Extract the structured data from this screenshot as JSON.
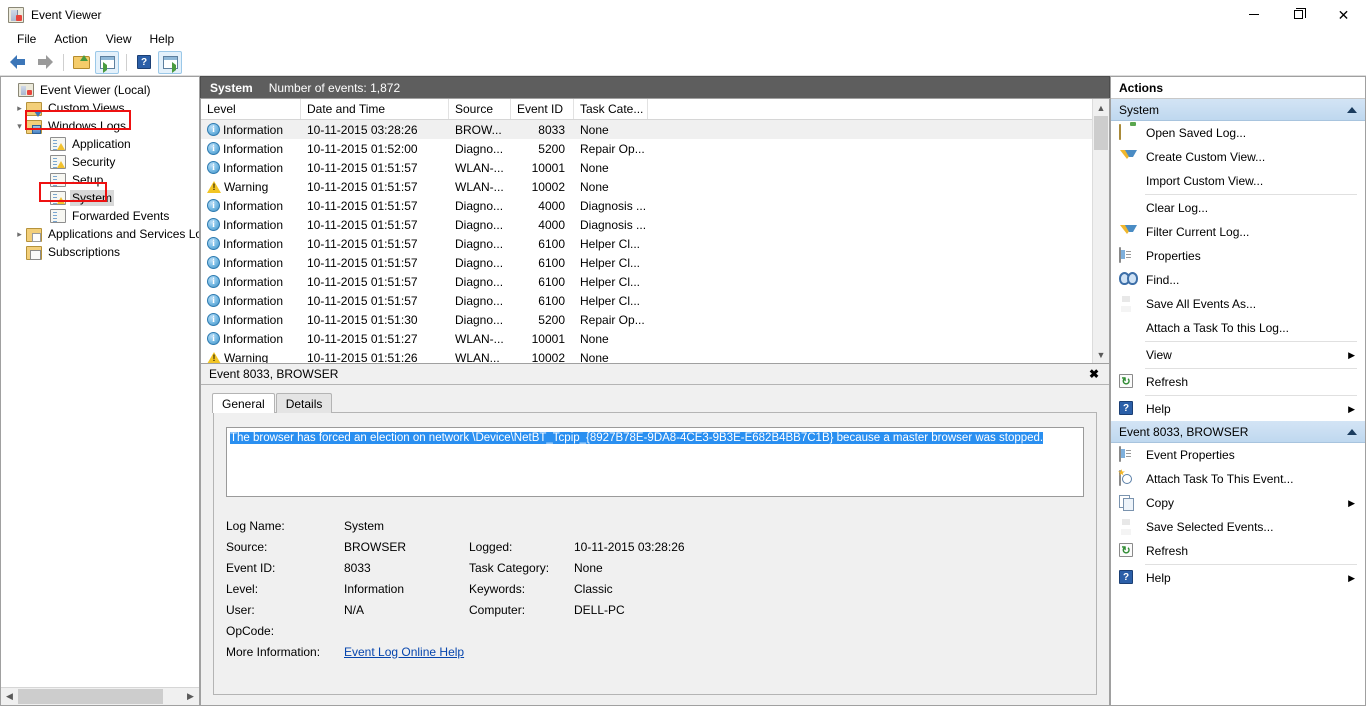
{
  "window": {
    "title": "Event Viewer",
    "app_icon": "event-viewer-icon",
    "minimize": "—",
    "maximize": "❐",
    "close": "✕"
  },
  "menubar": [
    "File",
    "Action",
    "View",
    "Help"
  ],
  "toolbar": [
    {
      "name": "back-button",
      "icon": "back-arrow-icon"
    },
    {
      "name": "forward-button",
      "icon": "forward-arrow-icon"
    },
    {
      "name": "open-saved-log-button",
      "icon": "folder-open-icon"
    },
    {
      "name": "show-hide-console-tree-button",
      "icon": "console-tree-icon"
    },
    {
      "name": "help-button",
      "icon": "question-mark-icon"
    },
    {
      "name": "show-hide-action-pane-button",
      "icon": "action-pane-icon"
    }
  ],
  "tree": {
    "items": [
      {
        "label": "Event Viewer (Local)",
        "indent": 0,
        "expander": "",
        "icon": "event-viewer-icon",
        "selected": false,
        "annotated": false
      },
      {
        "label": "Custom Views",
        "indent": 1,
        "expander": "›",
        "icon": "folder-filter-icon",
        "selected": false,
        "annotated": false
      },
      {
        "label": "Windows Logs",
        "indent": 1,
        "expander": "∨",
        "icon": "folder-windows-icon",
        "selected": false,
        "annotated": true
      },
      {
        "label": "Application",
        "indent": 2,
        "expander": "",
        "icon": "log-warning-icon",
        "selected": false,
        "annotated": false
      },
      {
        "label": "Security",
        "indent": 2,
        "expander": "",
        "icon": "log-warning-icon",
        "selected": false,
        "annotated": false
      },
      {
        "label": "Setup",
        "indent": 2,
        "expander": "",
        "icon": "log-icon",
        "selected": false,
        "annotated": false
      },
      {
        "label": "System",
        "indent": 2,
        "expander": "",
        "icon": "log-warning-icon",
        "selected": true,
        "annotated": true
      },
      {
        "label": "Forwarded Events",
        "indent": 2,
        "expander": "",
        "icon": "log-icon",
        "selected": false,
        "annotated": false
      },
      {
        "label": "Applications and Services Lo",
        "indent": 1,
        "expander": "›",
        "icon": "folder-services-icon",
        "selected": false,
        "annotated": false
      },
      {
        "label": "Subscriptions",
        "indent": 1,
        "expander": "",
        "icon": "subscriptions-icon",
        "selected": false,
        "annotated": false
      }
    ],
    "hscroll": {
      "left_arrow": "‹",
      "right_arrow": "›"
    }
  },
  "center": {
    "header": {
      "log_name": "System",
      "count_label": "Number of events: 1,872"
    },
    "columns": [
      "Level",
      "Date and Time",
      "Source",
      "Event ID",
      "Task Cate..."
    ],
    "rows": [
      {
        "level": "Information",
        "icon": "information-icon",
        "date": "10-11-2015 03:28:26",
        "source": "BROW...",
        "event_id": "8033",
        "task": "None",
        "selected": true
      },
      {
        "level": "Information",
        "icon": "information-icon",
        "date": "10-11-2015 01:52:00",
        "source": "Diagno...",
        "event_id": "5200",
        "task": "Repair Op...",
        "selected": false
      },
      {
        "level": "Information",
        "icon": "information-icon",
        "date": "10-11-2015 01:51:57",
        "source": "WLAN-...",
        "event_id": "10001",
        "task": "None",
        "selected": false
      },
      {
        "level": "Warning",
        "icon": "warning-icon",
        "date": "10-11-2015 01:51:57",
        "source": "WLAN-...",
        "event_id": "10002",
        "task": "None",
        "selected": false
      },
      {
        "level": "Information",
        "icon": "information-icon",
        "date": "10-11-2015 01:51:57",
        "source": "Diagno...",
        "event_id": "4000",
        "task": "Diagnosis ...",
        "selected": false
      },
      {
        "level": "Information",
        "icon": "information-icon",
        "date": "10-11-2015 01:51:57",
        "source": "Diagno...",
        "event_id": "4000",
        "task": "Diagnosis ...",
        "selected": false
      },
      {
        "level": "Information",
        "icon": "information-icon",
        "date": "10-11-2015 01:51:57",
        "source": "Diagno...",
        "event_id": "6100",
        "task": "Helper Cl...",
        "selected": false
      },
      {
        "level": "Information",
        "icon": "information-icon",
        "date": "10-11-2015 01:51:57",
        "source": "Diagno...",
        "event_id": "6100",
        "task": "Helper Cl...",
        "selected": false
      },
      {
        "level": "Information",
        "icon": "information-icon",
        "date": "10-11-2015 01:51:57",
        "source": "Diagno...",
        "event_id": "6100",
        "task": "Helper Cl...",
        "selected": false
      },
      {
        "level": "Information",
        "icon": "information-icon",
        "date": "10-11-2015 01:51:57",
        "source": "Diagno...",
        "event_id": "6100",
        "task": "Helper Cl...",
        "selected": false
      },
      {
        "level": "Information",
        "icon": "information-icon",
        "date": "10-11-2015 01:51:30",
        "source": "Diagno...",
        "event_id": "5200",
        "task": "Repair Op...",
        "selected": false
      },
      {
        "level": "Information",
        "icon": "information-icon",
        "date": "10-11-2015 01:51:27",
        "source": "WLAN-...",
        "event_id": "10001",
        "task": "None",
        "selected": false
      },
      {
        "level": "Warning",
        "icon": "warning-icon",
        "date": "10-11-2015 01:51:26",
        "source": "WLAN...",
        "event_id": "10002",
        "task": "None",
        "selected": false
      }
    ]
  },
  "detail": {
    "title": "Event 8033, BROWSER",
    "close_label": "✖",
    "tabs": [
      {
        "label": "General",
        "active": true
      },
      {
        "label": "Details",
        "active": false
      }
    ],
    "message": "The browser has forced an election on network \\Device\\NetBT_Tcpip_{8927B78E-9DA8-4CE3-9B3E-E682B4BB7C1B} because a master browser was stopped.",
    "fields_left": [
      {
        "label": "Log Name:",
        "value": "System"
      },
      {
        "label": "Source:",
        "value": "BROWSER"
      },
      {
        "label": "Event ID:",
        "value": "8033"
      },
      {
        "label": "Level:",
        "value": "Information"
      },
      {
        "label": "User:",
        "value": "N/A"
      },
      {
        "label": "OpCode:",
        "value": ""
      }
    ],
    "fields_right": [
      {
        "label": "",
        "value": ""
      },
      {
        "label": "Logged:",
        "value": "10-11-2015 03:28:26"
      },
      {
        "label": "Task Category:",
        "value": "None"
      },
      {
        "label": "Keywords:",
        "value": "Classic"
      },
      {
        "label": "Computer:",
        "value": "DELL-PC"
      },
      {
        "label": "",
        "value": ""
      }
    ],
    "more_info_label": "More Information:",
    "more_info_link": "Event Log Online Help"
  },
  "actions": {
    "title": "Actions",
    "groups": [
      {
        "name": "System",
        "collapse_icon": "collapse-caret-icon",
        "items": [
          {
            "label": "Open Saved Log...",
            "icon": "open-saved-log-icon",
            "submenu": false,
            "sep_after": false
          },
          {
            "label": "Create Custom View...",
            "icon": "filter-icon",
            "submenu": false,
            "sep_after": false
          },
          {
            "label": "Import Custom View...",
            "icon": "",
            "submenu": false,
            "sep_after": true
          },
          {
            "label": "Clear Log...",
            "icon": "",
            "submenu": false,
            "sep_after": false
          },
          {
            "label": "Filter Current Log...",
            "icon": "filter-icon",
            "submenu": false,
            "sep_after": false
          },
          {
            "label": "Properties",
            "icon": "properties-icon",
            "submenu": false,
            "sep_after": false
          },
          {
            "label": "Find...",
            "icon": "find-icon",
            "submenu": false,
            "sep_after": false
          },
          {
            "label": "Save All Events As...",
            "icon": "save-icon",
            "submenu": false,
            "sep_after": false
          },
          {
            "label": "Attach a Task To this Log...",
            "icon": "",
            "submenu": false,
            "sep_after": true
          },
          {
            "label": "View",
            "icon": "",
            "submenu": true,
            "sep_after": true
          },
          {
            "label": "Refresh",
            "icon": "refresh-icon",
            "submenu": false,
            "sep_after": true
          },
          {
            "label": "Help",
            "icon": "help-icon",
            "submenu": true,
            "sep_after": false
          }
        ]
      },
      {
        "name": "Event 8033, BROWSER",
        "collapse_icon": "collapse-caret-icon",
        "items": [
          {
            "label": "Event Properties",
            "icon": "properties-icon",
            "submenu": false,
            "sep_after": false
          },
          {
            "label": "Attach Task To This Event...",
            "icon": "attach-task-icon",
            "submenu": false,
            "sep_after": false
          },
          {
            "label": "Copy",
            "icon": "copy-icon",
            "submenu": true,
            "sep_after": false
          },
          {
            "label": "Save Selected Events...",
            "icon": "save-icon",
            "submenu": false,
            "sep_after": false
          },
          {
            "label": "Refresh",
            "icon": "refresh-icon",
            "submenu": false,
            "sep_after": true
          },
          {
            "label": "Help",
            "icon": "help-icon",
            "submenu": true,
            "sep_after": false
          }
        ]
      }
    ]
  },
  "colors": {
    "header_bar": "#5e5e5e",
    "group_header": "#c6dcf0",
    "selection": "#2a8ff0",
    "link": "#0645ad",
    "annotation": "#ee1111"
  }
}
